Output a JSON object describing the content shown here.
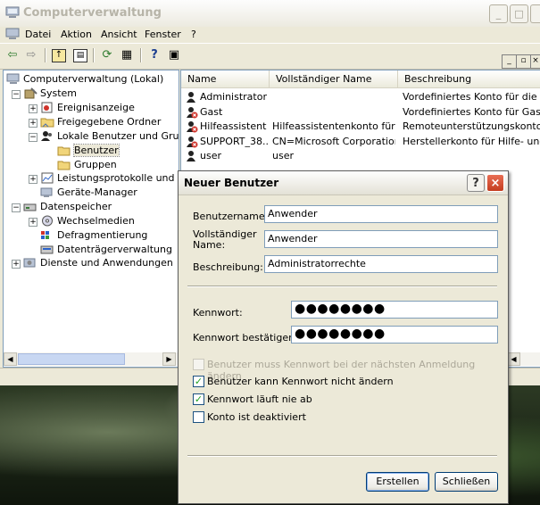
{
  "window": {
    "title": "Computerverwaltung",
    "controls": [
      "_",
      "□",
      "×"
    ]
  },
  "menu": [
    "Datei",
    "Aktion",
    "Ansicht",
    "Fenster",
    "?"
  ],
  "mdi_controls": [
    "_",
    "▫",
    "×"
  ],
  "tree": {
    "root": "Computerverwaltung (Lokal)",
    "system": "System",
    "ereignisanzeige": "Ereignisanzeige",
    "freigegebene_ordner": "Freigegebene Ordner",
    "lokale_benutzer": "Lokale Benutzer und Gruppe",
    "benutzer": "Benutzer",
    "gruppen": "Gruppen",
    "leistungsprotokolle": "Leistungsprotokolle und War",
    "geraete_manager": "Geräte-Manager",
    "datenspeicher": "Datenspeicher",
    "wechselmedien": "Wechselmedien",
    "defragmentierung": "Defragmentierung",
    "datentraegerverwaltung": "Datenträgerverwaltung",
    "dienste": "Dienste und Anwendungen"
  },
  "list": {
    "columns": [
      "Name",
      "Vollständiger Name",
      "Beschreibung"
    ],
    "rows": [
      {
        "name": "Administrator",
        "fullname": "",
        "description": "Vordefiniertes Konto für die Verw",
        "disabled": false
      },
      {
        "name": "Gast",
        "fullname": "",
        "description": "Vordefiniertes Konto für Gastzugr",
        "disabled": true
      },
      {
        "name": "Hilfeassistent",
        "fullname": "Hilfeassistentenkonto für ...",
        "description": "Remoteunterstützungskonto",
        "disabled": true
      },
      {
        "name": "SUPPORT_38...",
        "fullname": "CN=Microsoft Corporation...",
        "description": "Herstellerkonto für Hilfe- und Sup",
        "disabled": true
      },
      {
        "name": "user",
        "fullname": "user",
        "description": "",
        "disabled": false
      }
    ]
  },
  "dialog": {
    "title": "Neuer Benutzer",
    "help": "?",
    "close": "×",
    "benutzername_label": "Benutzername:",
    "benutzername_value": "Anwender",
    "vollstaendiger_label_1": "Vollständiger",
    "vollstaendiger_label_2": "Name:",
    "vollstaendiger_value": "Anwender",
    "beschreibung_label": "Beschreibung:",
    "beschreibung_value": "Administratorrechte",
    "kennwort_label": "Kennwort:",
    "kennwort_value": "●●●●●●●●",
    "bestaetigen_label": "Kennwort bestätigen:",
    "bestaetigen_value": "●●●●●●●●",
    "checkboxes": [
      {
        "label": "Benutzer muss Kennwort bei der nächsten Anmeldung ändern",
        "checked": false,
        "enabled": false
      },
      {
        "label": "Benutzer kann Kennwort nicht ändern",
        "checked": true,
        "enabled": true
      },
      {
        "label": "Kennwort läuft nie ab",
        "checked": true,
        "enabled": true
      },
      {
        "label": "Konto ist deaktiviert",
        "checked": false,
        "enabled": true
      }
    ],
    "create_button": "Erstellen",
    "close_button": "Schließen"
  },
  "colors": {
    "accent": "#0a246a",
    "close_red": "#c43c1e",
    "check_green": "#21a121",
    "window_bg": "#ece9d8"
  }
}
